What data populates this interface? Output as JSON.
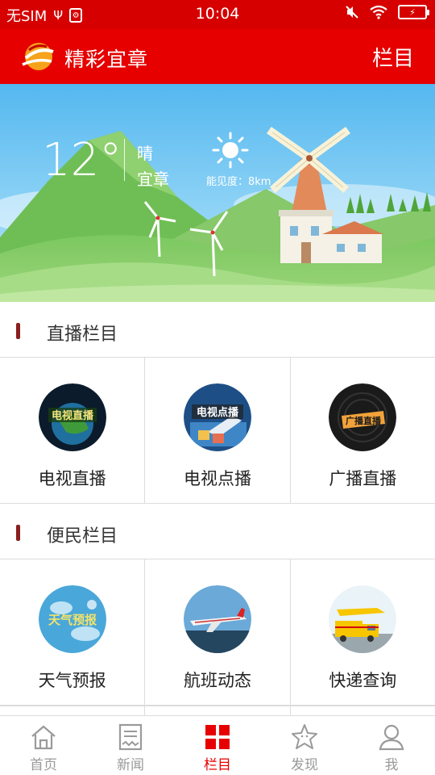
{
  "status_bar": {
    "carrier": "无SIM",
    "time": "10:04"
  },
  "app_bar": {
    "title": "精彩宜章",
    "right_label": "栏目"
  },
  "weather": {
    "temperature": "12°",
    "condition": "晴",
    "city": "宜章",
    "visibility": "能见度：8km"
  },
  "sections": [
    {
      "title": "直播栏目",
      "items": [
        {
          "label": "电视直播",
          "icon": "tv-live-icon"
        },
        {
          "label": "电视点播",
          "icon": "tv-vod-icon"
        },
        {
          "label": "广播直播",
          "icon": "radio-live-icon"
        }
      ]
    },
    {
      "title": "便民栏目",
      "items": [
        {
          "label": "天气预报",
          "icon": "weather-forecast-icon"
        },
        {
          "label": "航班动态",
          "icon": "flight-status-icon"
        },
        {
          "label": "快递查询",
          "icon": "express-tracking-icon"
        }
      ]
    }
  ],
  "bottom_nav": [
    {
      "label": "首页",
      "icon": "home-icon"
    },
    {
      "label": "新闻",
      "icon": "news-icon"
    },
    {
      "label": "栏目",
      "icon": "columns-grid-icon",
      "active": true
    },
    {
      "label": "发现",
      "icon": "discover-star-icon"
    },
    {
      "label": "我",
      "icon": "user-icon"
    }
  ],
  "colors": {
    "brand_red": "#e60000",
    "status_red": "#d60000",
    "active_nav": "#e60000",
    "inactive_nav": "#9a9a9a"
  }
}
